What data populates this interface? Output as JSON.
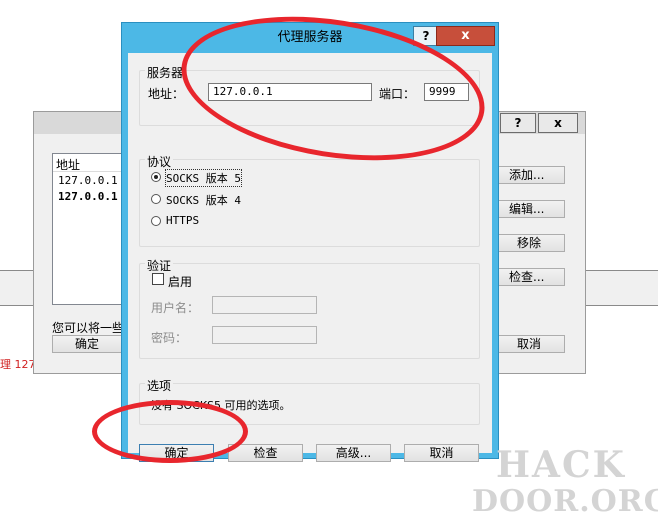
{
  "background": {
    "red_text": "理 127"
  },
  "back_dialog": {
    "help_btn": "?",
    "close_btn": "x",
    "list_header": "地址",
    "list_rows": [
      "127.0.0.1",
      "127.0.0.1"
    ],
    "note_text": "您可以将一些",
    "ok_btn": "确定",
    "buttons": {
      "add": "添加...",
      "edit": "编辑...",
      "remove": "移除",
      "check": "检查...",
      "cancel": "取消"
    }
  },
  "proxy_dialog": {
    "title": "代理服务器",
    "help_btn": "?",
    "close_btn": "x",
    "server": {
      "group_label": "服务器",
      "address_label": "地址：",
      "address_value": "127.0.0.1",
      "port_label": "端口：",
      "port_value": "9999"
    },
    "protocol": {
      "group_label": "协议",
      "options": [
        "SOCKS 版本 5",
        "SOCKS 版本 4",
        "HTTPS"
      ],
      "selected": "SOCKS 版本 5"
    },
    "auth": {
      "group_label": "验证",
      "enable_label": "启用",
      "enabled": false,
      "username_label": "用户名：",
      "password_label": "密码："
    },
    "options": {
      "group_label": "选项",
      "text": "没有 SOCKS5 可用的选项。"
    },
    "buttons": {
      "ok": "确定",
      "check": "检查",
      "advanced": "高级...",
      "cancel": "取消"
    }
  },
  "annotations": {
    "color": "#e8262d"
  },
  "watermark": {
    "line1": "HACK",
    "line2": "DOOR.ORG"
  }
}
